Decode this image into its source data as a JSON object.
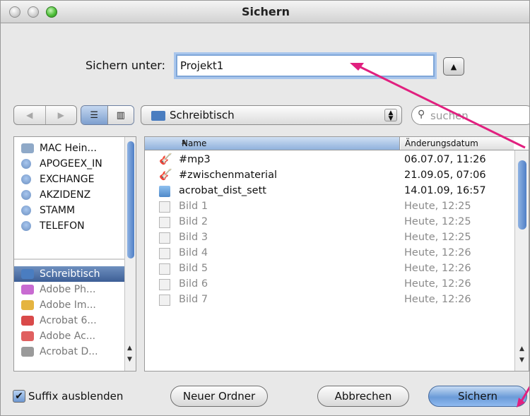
{
  "window": {
    "title": "Sichern"
  },
  "save_as": {
    "label": "Sichern unter:",
    "value": "Projekt1"
  },
  "toolbar": {
    "back_label": "◀",
    "forward_label": "▶",
    "location": "Schreibtisch",
    "search_placeholder": "suchen"
  },
  "sidebar": {
    "items": [
      {
        "label": "MAC Hein...",
        "kind": "computer"
      },
      {
        "label": "APOGEEX_IN",
        "kind": "volume"
      },
      {
        "label": "EXCHANGE",
        "kind": "volume"
      },
      {
        "label": "AKZIDENZ",
        "kind": "volume"
      },
      {
        "label": "STAMM",
        "kind": "volume"
      },
      {
        "label": "TELEFON",
        "kind": "volume"
      },
      {
        "label": "Schreibtisch",
        "kind": "place",
        "selected": true
      },
      {
        "label": "Adobe Ph...",
        "kind": "app"
      },
      {
        "label": "Adobe Im...",
        "kind": "app"
      },
      {
        "label": "Acrobat 6...",
        "kind": "app"
      },
      {
        "label": "Adobe Ac...",
        "kind": "app"
      },
      {
        "label": "Acrobat D...",
        "kind": "app"
      }
    ]
  },
  "files": {
    "columns": {
      "name": "Name",
      "date": "Änderungsdatum"
    },
    "rows": [
      {
        "name": "#mp3",
        "date": "06.07.07, 11:26",
        "icon": "music-icon",
        "enabled": true
      },
      {
        "name": "#zwischenmaterial",
        "date": "21.09.05, 07:06",
        "icon": "music-icon",
        "enabled": true
      },
      {
        "name": "acrobat_dist_sett",
        "date": "14.01.09, 16:57",
        "icon": "folder-icon",
        "enabled": true
      },
      {
        "name": "Bild 1",
        "date": "Heute, 12:25",
        "icon": "image-icon",
        "enabled": false
      },
      {
        "name": "Bild 2",
        "date": "Heute, 12:25",
        "icon": "image-icon",
        "enabled": false
      },
      {
        "name": "Bild 3",
        "date": "Heute, 12:25",
        "icon": "image-icon",
        "enabled": false
      },
      {
        "name": "Bild 4",
        "date": "Heute, 12:26",
        "icon": "image-icon",
        "enabled": false
      },
      {
        "name": "Bild 5",
        "date": "Heute, 12:26",
        "icon": "image-icon",
        "enabled": false
      },
      {
        "name": "Bild 6",
        "date": "Heute, 12:26",
        "icon": "image-icon",
        "enabled": false
      },
      {
        "name": "Bild 7",
        "date": "Heute, 12:26",
        "icon": "image-icon",
        "enabled": false
      }
    ]
  },
  "footer": {
    "suffix_label": "Suffix ausblenden",
    "suffix_checked": true,
    "new_folder": "Neuer Ordner",
    "cancel": "Abbrechen",
    "save": "Sichern"
  },
  "annotation_color": "#e1207f"
}
